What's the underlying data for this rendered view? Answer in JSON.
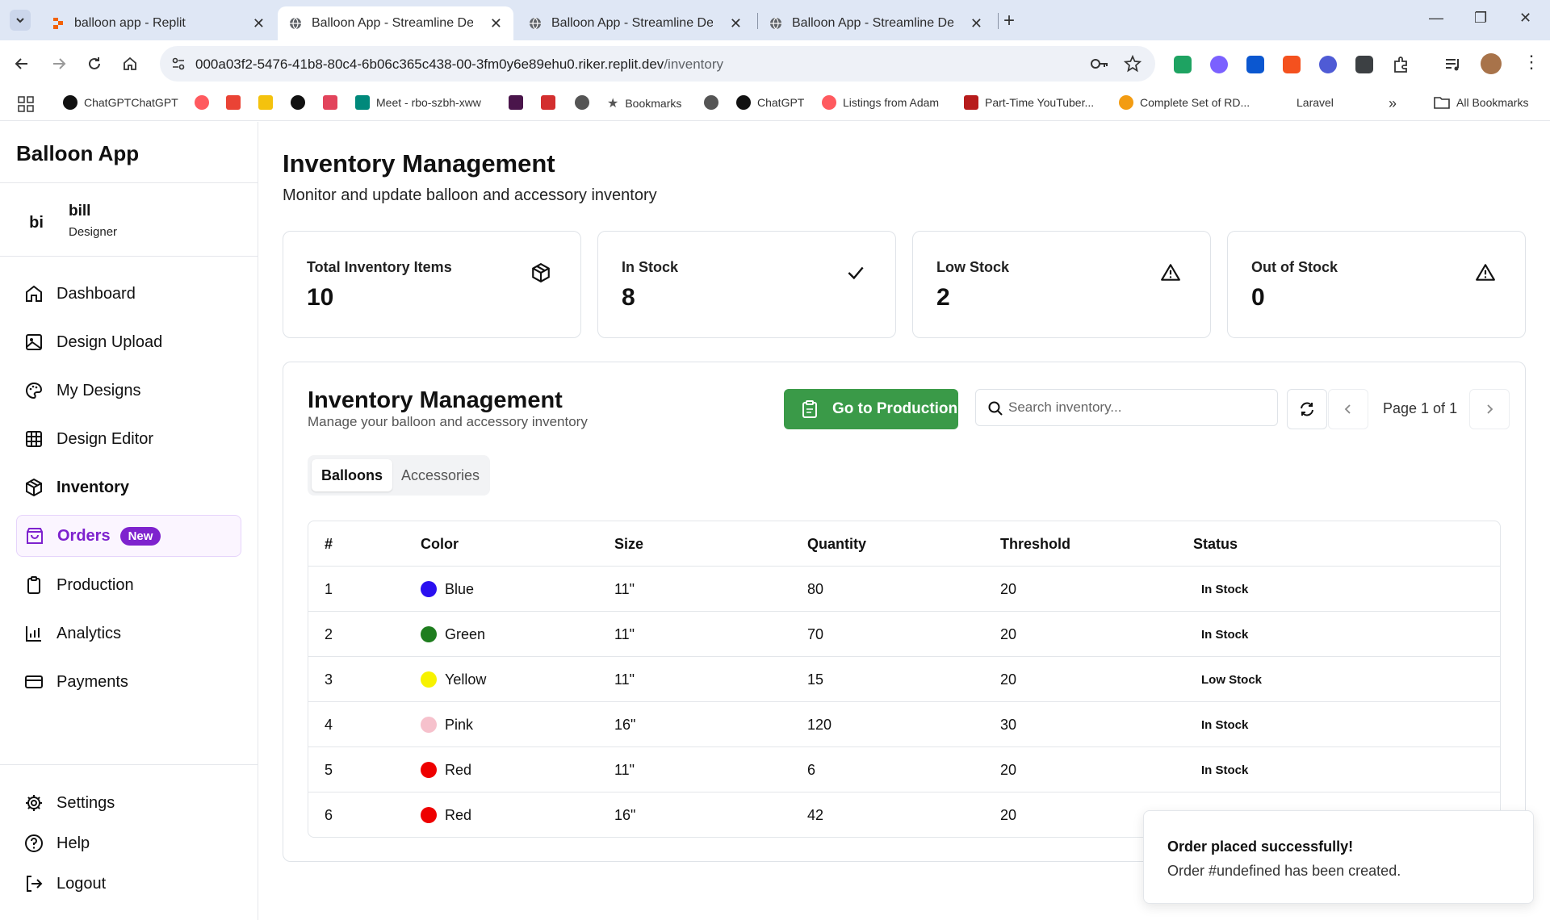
{
  "browser": {
    "tabs": [
      {
        "title": "balloon app - Replit",
        "favicon": "replit-icon",
        "active": false
      },
      {
        "title": "Balloon App - Streamline Design",
        "favicon": "globe-icon",
        "active": true
      },
      {
        "title": "Balloon App - Streamline Design",
        "favicon": "globe-icon",
        "active": false
      },
      {
        "title": "Balloon App - Streamline Design",
        "favicon": "globe-icon",
        "active": false
      }
    ],
    "url_host": "000a03f2-5476-41b8-80c4-6b06c365c438-00-3fm0y6e89ehu0.riker.replit.dev",
    "url_path": "/inventory",
    "bookmarks": [
      {
        "label": "ChatGPTChatGPT",
        "color": "#111111"
      },
      {
        "label": "",
        "color": "#ff5a5f"
      },
      {
        "label": "",
        "color": "#ea4335"
      },
      {
        "label": "",
        "color": "#f4c20d"
      },
      {
        "label": "",
        "color": "#111111"
      },
      {
        "label": "",
        "color": "#e2445c"
      },
      {
        "label": "Meet - rbo-szbh-xww",
        "color": "#00897b"
      },
      {
        "label": "",
        "color": "#4a154b"
      },
      {
        "label": "",
        "color": "#d32f2f"
      },
      {
        "label": "",
        "color": "#555555"
      },
      {
        "label": "Bookmarks",
        "color": "#555555"
      },
      {
        "label": "",
        "color": "#555555"
      },
      {
        "label": "ChatGPT",
        "color": "#111111"
      },
      {
        "label": "Listings from Adam",
        "color": "#ff5a5f"
      },
      {
        "label": "Part-Time YouTuber...",
        "color": "#b71c1c"
      },
      {
        "label": "Complete Set of RD...",
        "color": "#f39c12"
      },
      {
        "label": "Laravel",
        "color": "#ffffff"
      }
    ],
    "more_bookmarks": "»",
    "all_bookmarks": "All Bookmarks"
  },
  "sidebar": {
    "brand": "Balloon App",
    "user": {
      "initials": "bi",
      "name": "bill",
      "role": "Designer"
    },
    "nav": [
      {
        "label": "Dashboard",
        "icon": "home-icon"
      },
      {
        "label": "Design Upload",
        "icon": "image-icon"
      },
      {
        "label": "My Designs",
        "icon": "palette-icon"
      },
      {
        "label": "Design Editor",
        "icon": "grid-icon"
      },
      {
        "label": "Inventory",
        "icon": "box-icon"
      },
      {
        "label": "Orders",
        "icon": "shopping-bag-icon",
        "badge": "New"
      },
      {
        "label": "Production",
        "icon": "clipboard-icon"
      },
      {
        "label": "Analytics",
        "icon": "bar-chart-icon"
      },
      {
        "label": "Payments",
        "icon": "credit-card-icon"
      }
    ],
    "footer": [
      {
        "label": "Settings",
        "icon": "gear-icon"
      },
      {
        "label": "Help",
        "icon": "help-circle-icon"
      },
      {
        "label": "Logout",
        "icon": "logout-icon"
      }
    ]
  },
  "header": {
    "title": "Inventory Management",
    "subtitle": "Monitor and update balloon and accessory inventory"
  },
  "stats": [
    {
      "label": "Total Inventory Items",
      "value": "10",
      "icon": "box-icon"
    },
    {
      "label": "In Stock",
      "value": "8",
      "icon": "check-icon"
    },
    {
      "label": "Low Stock",
      "value": "2",
      "icon": "alert-triangle-icon"
    },
    {
      "label": "Out of Stock",
      "value": "0",
      "icon": "alert-triangle-icon"
    }
  ],
  "panel": {
    "title": "Inventory Management",
    "subtitle": "Manage your balloon and accessory inventory",
    "production_button": "Go to Production",
    "search_placeholder": "Search inventory...",
    "pager": "Page 1 of 1",
    "tabs": [
      "Balloons",
      "Accessories"
    ],
    "columns": [
      "#",
      "Color",
      "Size",
      "Quantity",
      "Threshold",
      "Status"
    ],
    "rows": [
      {
        "num": "1",
        "color": "Blue",
        "swatch": "#2a0ff0",
        "size": "11\"",
        "quantity": "80",
        "threshold": "20",
        "status": "In Stock"
      },
      {
        "num": "2",
        "color": "Green",
        "swatch": "#1e7d1e",
        "size": "11\"",
        "quantity": "70",
        "threshold": "20",
        "status": "In Stock"
      },
      {
        "num": "3",
        "color": "Yellow",
        "swatch": "#f7f200",
        "size": "11\"",
        "quantity": "15",
        "threshold": "20",
        "status": "Low Stock"
      },
      {
        "num": "4",
        "color": "Pink",
        "swatch": "#f6c1cc",
        "size": "16\"",
        "quantity": "120",
        "threshold": "30",
        "status": "In Stock"
      },
      {
        "num": "5",
        "color": "Red",
        "swatch": "#ee0000",
        "size": "11\"",
        "quantity": "6",
        "threshold": "20",
        "status": "In Stock"
      },
      {
        "num": "6",
        "color": "Red",
        "swatch": "#ee0000",
        "size": "16\"",
        "quantity": "42",
        "threshold": "20",
        "status": ""
      }
    ]
  },
  "toast": {
    "title": "Order placed successfully!",
    "message": "Order #undefined has been created."
  },
  "colors": {
    "accent": "#7e22ce",
    "primary_button": "#3a9a48"
  }
}
